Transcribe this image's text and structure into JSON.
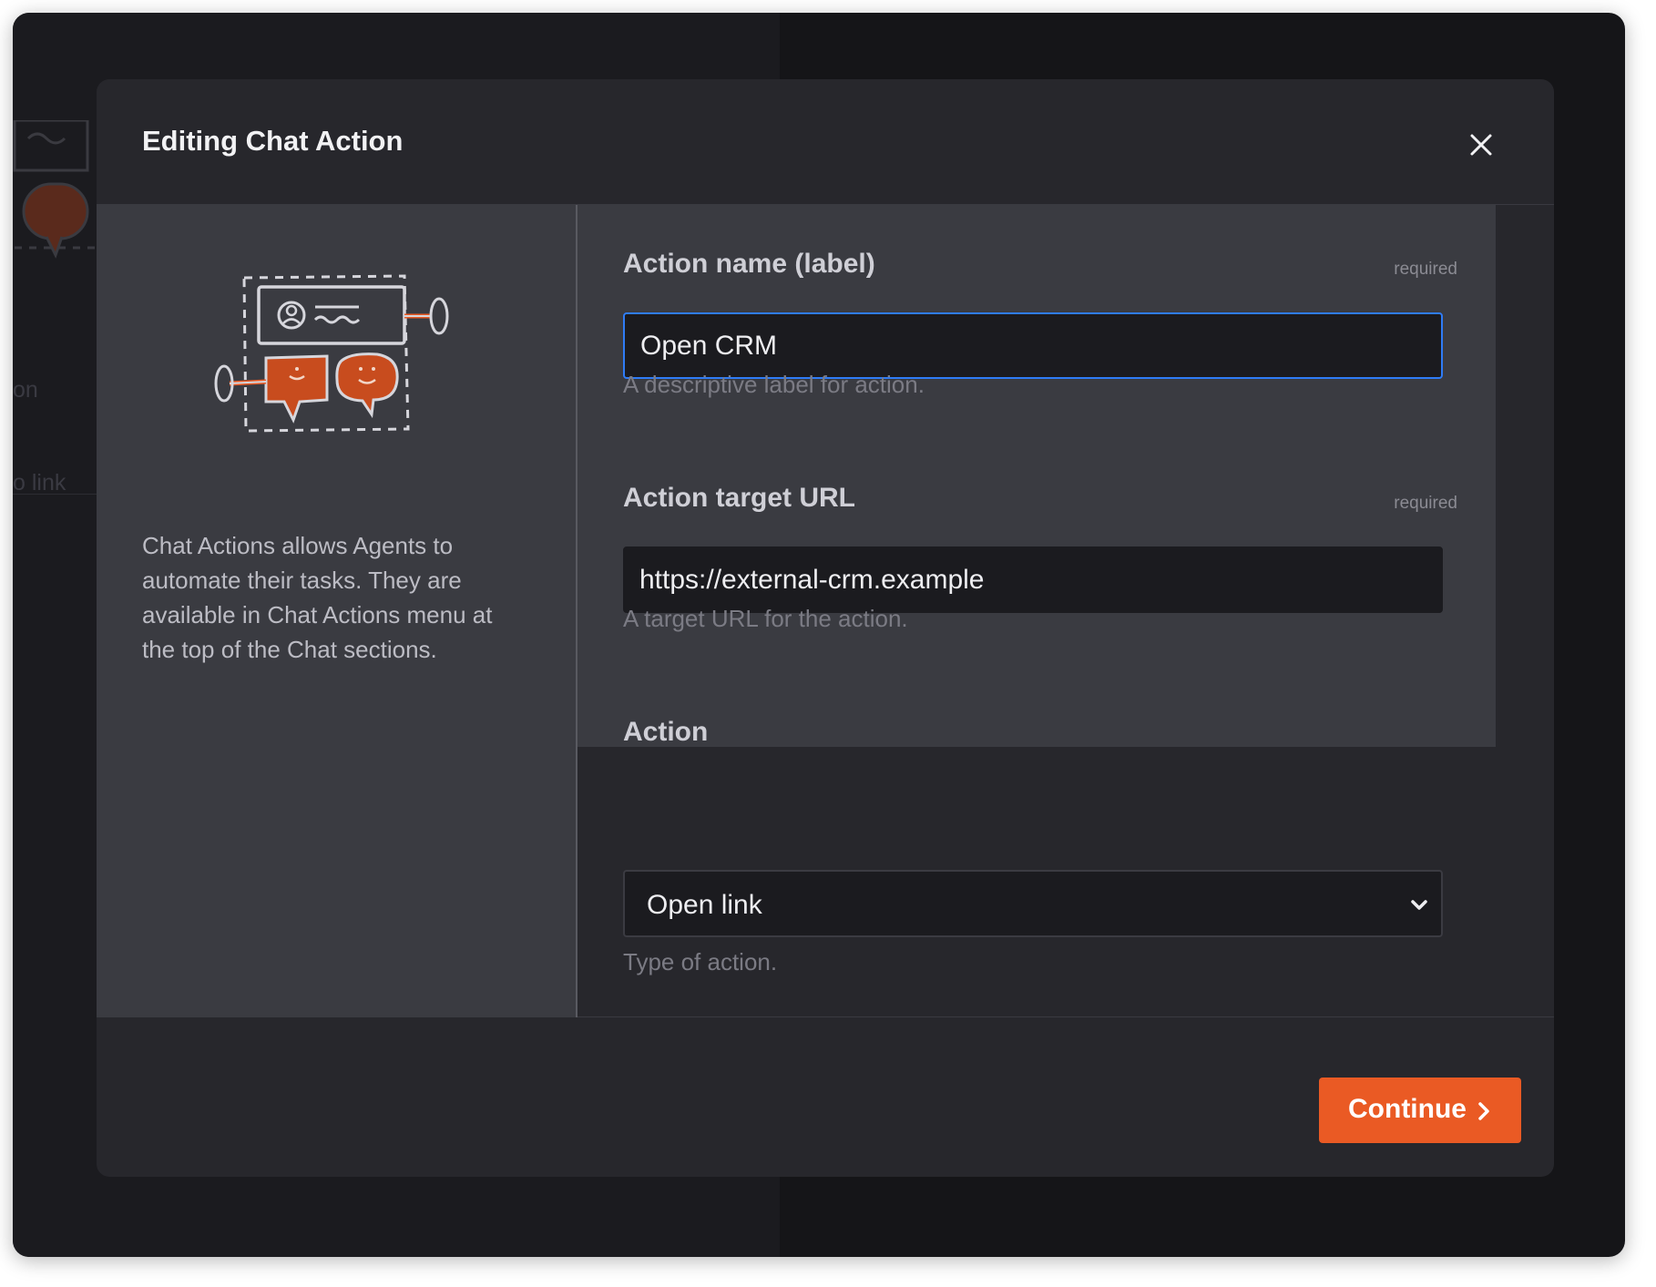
{
  "background": {
    "items": [
      "on",
      "o link"
    ]
  },
  "modal": {
    "title": "Editing Chat Action",
    "close_icon": "close-icon",
    "illustration_icon": "chat-actions-illustration-icon",
    "description": "Chat Actions allows Agents to automate their tasks. They are available in Chat Actions menu at the top of the Chat sections.",
    "fields": {
      "action_name": {
        "label": "Action name (label)",
        "required_text": "required",
        "value": "Open CRM",
        "hint": "A descriptive label for action.",
        "focused": true
      },
      "target_url": {
        "label": "Action target URL",
        "required_text": "required",
        "value": "https://external-crm.example",
        "hint": "A target URL for the action."
      },
      "action": {
        "label": "Action",
        "selected": "Open link",
        "hint": "Type of action."
      }
    },
    "continue_label": "Continue"
  },
  "colors": {
    "accent": "#ea5a24",
    "focus_border": "#2f7cf6",
    "modal_bg": "#27272c",
    "panel_bg": "#3a3b41",
    "input_bg": "#1b1b1f"
  }
}
